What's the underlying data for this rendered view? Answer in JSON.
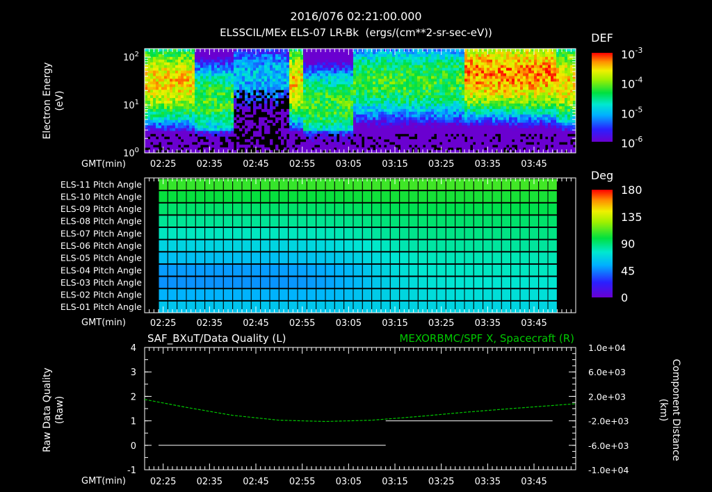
{
  "header": {
    "timestamp": "2016/076 02:21:00.000",
    "panel1_title": "ELSSCIL/MEx ELS-07 LR-Bk  (ergs/(cm**2-sr-sec-eV))"
  },
  "time_axis": {
    "label": "GMT(min)",
    "ticks": [
      "02:25",
      "02:35",
      "02:45",
      "02:55",
      "03:05",
      "03:15",
      "03:25",
      "03:35",
      "03:45"
    ],
    "tick_minutes": [
      145,
      155,
      165,
      175,
      185,
      195,
      205,
      215,
      225
    ],
    "range_minutes": [
      141,
      234
    ]
  },
  "chart_data": [
    {
      "type": "heatmap",
      "name": "spectrogram",
      "ylabel_line1": "Electron Energy",
      "ylabel_line2": "(eV)",
      "yscale": "log",
      "ylim": [
        1,
        150
      ],
      "y_ticks": [
        {
          "value": 1,
          "base": "10",
          "exp": "0"
        },
        {
          "value": 10,
          "base": "10",
          "exp": "1"
        },
        {
          "value": 100,
          "base": "10",
          "exp": "2"
        }
      ],
      "colorbar": {
        "title": "DEF",
        "scale": "log",
        "range": [
          1e-06,
          0.001
        ],
        "ticks": [
          {
            "value": 0.001,
            "base": "10",
            "exp": "-3"
          },
          {
            "value": 0.0001,
            "base": "10",
            "exp": "-4"
          },
          {
            "value": 1e-05,
            "base": "10",
            "exp": "-5"
          },
          {
            "value": 1e-06,
            "base": "10",
            "exp": "-6"
          }
        ]
      },
      "features": [
        {
          "t_start": 141,
          "t_end": 152,
          "e_center": 30,
          "level": 0.0003
        },
        {
          "t_start": 152,
          "t_end": 160,
          "e_center": 12,
          "level": 6e-05
        },
        {
          "t_start": 160,
          "t_end": 172,
          "e_center": 40,
          "level": 1e-05
        },
        {
          "t_start": 175,
          "t_end": 186,
          "e_center": 10,
          "level": 6e-05
        },
        {
          "t_start": 186,
          "t_end": 210,
          "e_center": 30,
          "level": 6e-05
        },
        {
          "t_start": 210,
          "t_end": 230,
          "e_center": 45,
          "level": 0.0005
        }
      ]
    },
    {
      "type": "heatmap",
      "name": "pitch-angle",
      "row_labels": [
        "ELS-11 Pitch Angle",
        "ELS-10 Pitch Angle",
        "ELS-09 Pitch Angle",
        "ELS-08 Pitch Angle",
        "ELS-07 Pitch Angle",
        "ELS-06 Pitch Angle",
        "ELS-05 Pitch Angle",
        "ELS-04 Pitch Angle",
        "ELS-03 Pitch Angle",
        "ELS-02 Pitch Angle",
        "ELS-01 Pitch Angle"
      ],
      "data_range_minutes": [
        144,
        230
      ],
      "row_start_deg": [
        108,
        100,
        92,
        85,
        78,
        68,
        60,
        50,
        48,
        55,
        62
      ],
      "row_end_deg": [
        110,
        103,
        97,
        92,
        88,
        84,
        80,
        78,
        75,
        72,
        68
      ],
      "transition_minute": 190,
      "colorbar": {
        "title": "Deg",
        "range": [
          0,
          180
        ],
        "ticks": [
          180,
          135,
          90,
          45,
          0
        ]
      }
    },
    {
      "type": "line",
      "name": "data-quality",
      "title_left": "SAF_BXuT/Data Quality (L)",
      "title_right": "MEXORBMC/SPF X, Spacecraft (R)",
      "ylabel_left_line1": "Raw Data Quality",
      "ylabel_left_line2": "(Raw)",
      "ylabel_right_line1": "Component Distance",
      "ylabel_right_line2": "(km)",
      "ylim_left": [
        -1,
        4
      ],
      "y_ticks_left": [
        -1,
        0,
        1,
        2,
        3,
        4
      ],
      "ylim_right": [
        -10000,
        10000
      ],
      "y_ticks_right": [
        {
          "value": 10000,
          "label": "1.0e+04"
        },
        {
          "value": 6000,
          "label": "6.0e+03"
        },
        {
          "value": 2000,
          "label": "2.0e+03"
        },
        {
          "value": -2000,
          "label": "-2.0e+03"
        },
        {
          "value": -6000,
          "label": "-6.0e+03"
        },
        {
          "value": -10000,
          "label": "-1.0e+04"
        }
      ],
      "series": [
        {
          "axis": "left",
          "color": "#ffffff",
          "style": "solid",
          "segments": [
            {
              "x": [
                144,
                193
              ],
              "y": [
                0,
                0
              ]
            },
            {
              "x": [
                193,
                229
              ],
              "y": [
                1,
                1
              ]
            }
          ]
        },
        {
          "axis": "right",
          "color": "#00c800",
          "style": "dashed",
          "x": [
            141,
            150,
            160,
            170,
            180,
            190,
            200,
            210,
            220,
            234
          ],
          "y": [
            1500,
            200,
            -1100,
            -1900,
            -2100,
            -1900,
            -1300,
            -600,
            0,
            800
          ]
        }
      ]
    }
  ]
}
